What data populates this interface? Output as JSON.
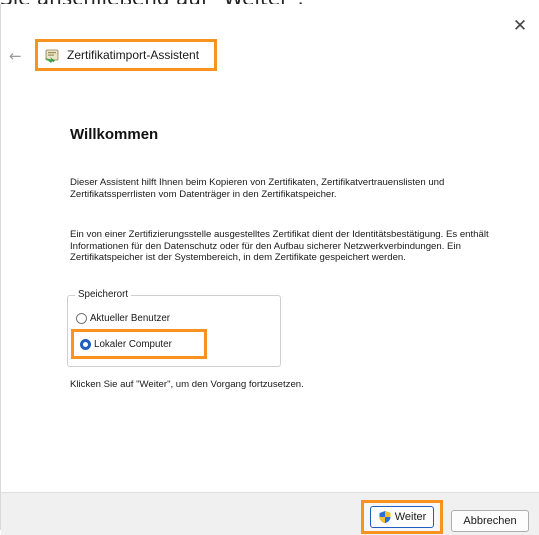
{
  "caption": "Sie anschließend auf \"Weiter\".",
  "window": {
    "title": "Zertifikatimport-Assistent",
    "close_glyph": "✕",
    "back_glyph": "←"
  },
  "content": {
    "heading": "Willkommen",
    "paragraph1": "Dieser Assistent hilft Ihnen beim Kopieren von Zertifikaten, Zertifikatvertrauenslisten und Zertifikatssperrlisten vom Datenträger in den Zertifikatspeicher.",
    "paragraph2": "Ein von einer Zertifizierungsstelle ausgestelltes Zertifikat dient der Identitätsbestätigung. Es enthält Informationen für den Datenschutz oder für den Aufbau sicherer Netzwerkverbindungen. Ein Zertifikatspeicher ist der Systembereich, in dem Zertifikate gespeichert werden.",
    "store_location": {
      "label": "Speicherort",
      "options": [
        {
          "label": "Aktueller Benutzer",
          "selected": false
        },
        {
          "label": "Lokaler Computer",
          "selected": true
        }
      ]
    },
    "paragraph3": "Klicken Sie auf \"Weiter\", um den Vorgang fortzusetzen."
  },
  "footer": {
    "next_label": "Weiter",
    "cancel_label": "Abbrechen"
  },
  "colors": {
    "highlight": "#f7931e",
    "radio_selected": "#1f5fbf",
    "footer_bg": "#f0f0f0"
  }
}
